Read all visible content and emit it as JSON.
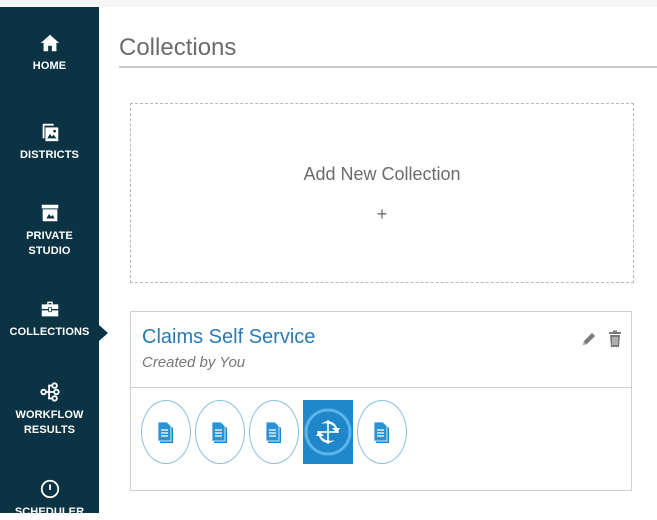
{
  "sidebar": {
    "items": [
      {
        "label": "HOME",
        "icon": "home-icon"
      },
      {
        "label": "DISTRICTS",
        "icon": "districts-icon"
      },
      {
        "label": "PRIVATE\nSTUDIO",
        "icon": "private-studio-icon"
      },
      {
        "label": "COLLECTIONS",
        "icon": "briefcase-icon"
      },
      {
        "label": "WORKFLOW\nRESULTS",
        "icon": "workflow-icon"
      },
      {
        "label": "SCHEDULER",
        "icon": "clock-icon"
      }
    ],
    "active": "COLLECTIONS"
  },
  "main": {
    "title": "Collections",
    "add_new": {
      "label": "Add New Collection",
      "plus": "+"
    },
    "collections": [
      {
        "name": "Claims Self Service",
        "created_by": "Created by You",
        "thumbnails": [
          "document-icon",
          "document-icon",
          "document-icon",
          "workflow-thumbnail",
          "document-icon"
        ]
      }
    ]
  },
  "colors": {
    "sidebar_bg": "#0b3344",
    "link_blue": "#2a7ab5",
    "thumb_border": "#8cc0e0",
    "workflow_tile": "#1e86c9"
  }
}
